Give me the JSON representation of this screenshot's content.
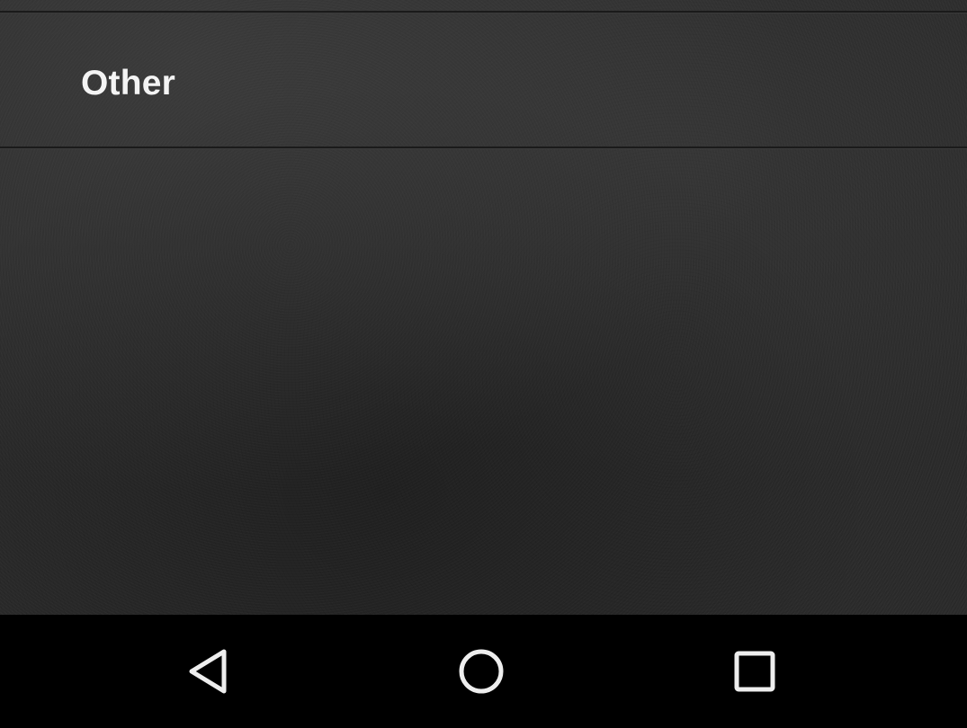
{
  "list": {
    "items": [
      {
        "label": "Other"
      }
    ]
  },
  "nav_bar": {
    "buttons": [
      {
        "name": "back",
        "icon": "back-triangle-icon"
      },
      {
        "name": "home",
        "icon": "home-circle-icon"
      },
      {
        "name": "recents",
        "icon": "recents-square-icon"
      }
    ],
    "icon_color": "#eeeeee",
    "background": "#000000"
  },
  "colors": {
    "content_background": "#2b2b2b",
    "title_text": "#f4f4f4",
    "divider": "#1b1b1b"
  }
}
